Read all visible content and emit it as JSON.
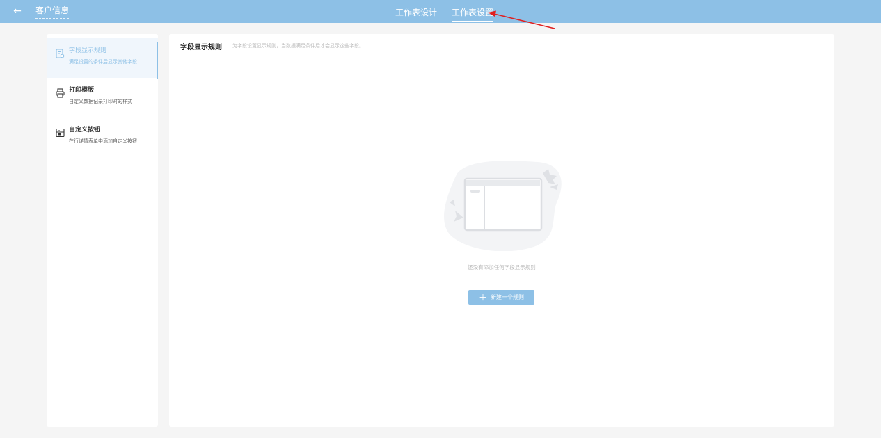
{
  "header": {
    "back_icon": "←",
    "title": "客户信息",
    "tabs": [
      {
        "label": "工作表设计",
        "active": false
      },
      {
        "label": "工作表设置",
        "active": true
      }
    ]
  },
  "sidebar": {
    "items": [
      {
        "icon": "field-rule-icon",
        "title": "字段显示规则",
        "subtitle": "满足设置的条件后显示其他字段",
        "active": true
      },
      {
        "icon": "printer-icon",
        "title": "打印模版",
        "subtitle": "自定义数据记录打印时的样式",
        "active": false
      },
      {
        "icon": "custom-button-icon",
        "title": "自定义按钮",
        "subtitle": "在行详情表单中添加自定义按钮",
        "active": false
      }
    ]
  },
  "main": {
    "title": "字段显示规则",
    "description": "为字段设置显示规则，当数据满足条件后才会显示这些字段。",
    "empty_text": "还没有添加任何字段显示规则",
    "new_button": {
      "icon": "＋",
      "label": "新建一个规则"
    }
  },
  "colors": {
    "accent": "#8dc0e6",
    "background": "#f5f5f5",
    "annotation_arrow": "#e02020"
  }
}
